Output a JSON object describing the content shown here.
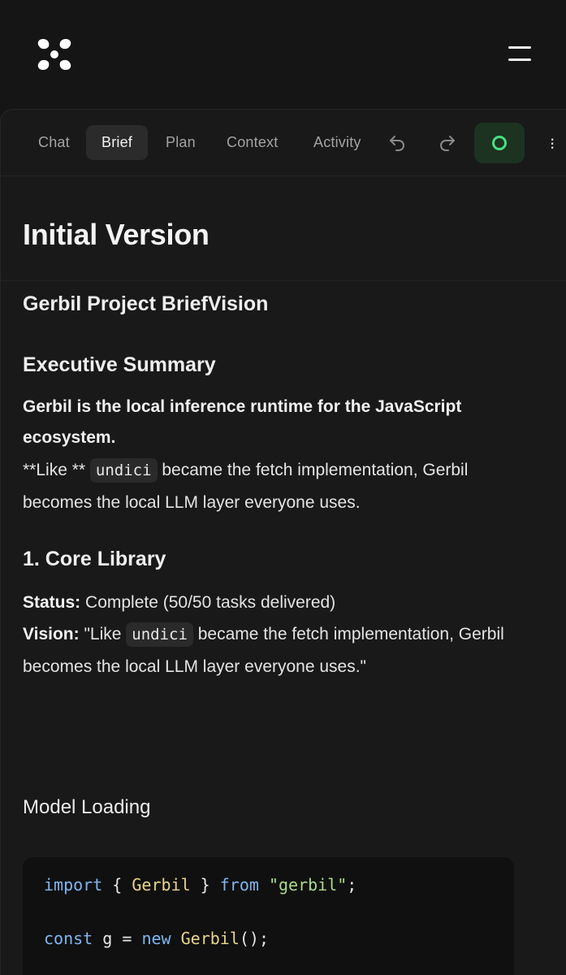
{
  "header": {
    "logo_icon": "four-petal-logo-icon",
    "menu_icon": "hamburger-menu-icon"
  },
  "tabs": [
    {
      "label": "Chat",
      "active": false
    },
    {
      "label": "Brief",
      "active": true
    },
    {
      "label": "Plan",
      "active": false
    },
    {
      "label": "Context",
      "active": false
    },
    {
      "label": "Activity",
      "active": false
    }
  ],
  "toolbar": {
    "undo_icon": "undo-icon",
    "redo_icon": "redo-icon",
    "status_icon": "status-ring-icon",
    "status_color": "#4ade80"
  },
  "doc": {
    "title": "Initial Version",
    "project_heading": "Gerbil Project BriefVision",
    "exec_heading": "Executive Summary",
    "lead": "Gerbil is the local inference runtime for the JavaScript ecosystem.",
    "like_prefix": "**Like ** ",
    "like_code": "undici",
    "like_suffix": " became the fetch implementation, Gerbil becomes the local LLM layer everyone uses.",
    "core_heading": "1. Core Library",
    "status_label": "Status:",
    "status_value": " Complete (50/50 tasks delivered)",
    "vision_label": "Vision:",
    "vision_prefix": " \"Like ",
    "vision_code": "undici",
    "vision_suffix": " became the fetch implementation, Gerbil becomes the local LLM layer everyone uses.\"",
    "model_heading": "Model Loading"
  },
  "code": {
    "line1": {
      "kw1": "import",
      "p1": " { ",
      "cls": "Gerbil",
      "p2": " } ",
      "kw2": "from",
      "p3": " ",
      "str": "\"gerbil\"",
      "p4": ";"
    },
    "line2": {
      "kw1": "const",
      "p1": " g = ",
      "kw2": "new",
      "p2": " ",
      "cls": "Gerbil",
      "p3": "();"
    }
  },
  "colors": {
    "background": "#151515",
    "panel": "#191919",
    "active_tab": "#2b2b2b",
    "status_bg": "#1c3321"
  }
}
